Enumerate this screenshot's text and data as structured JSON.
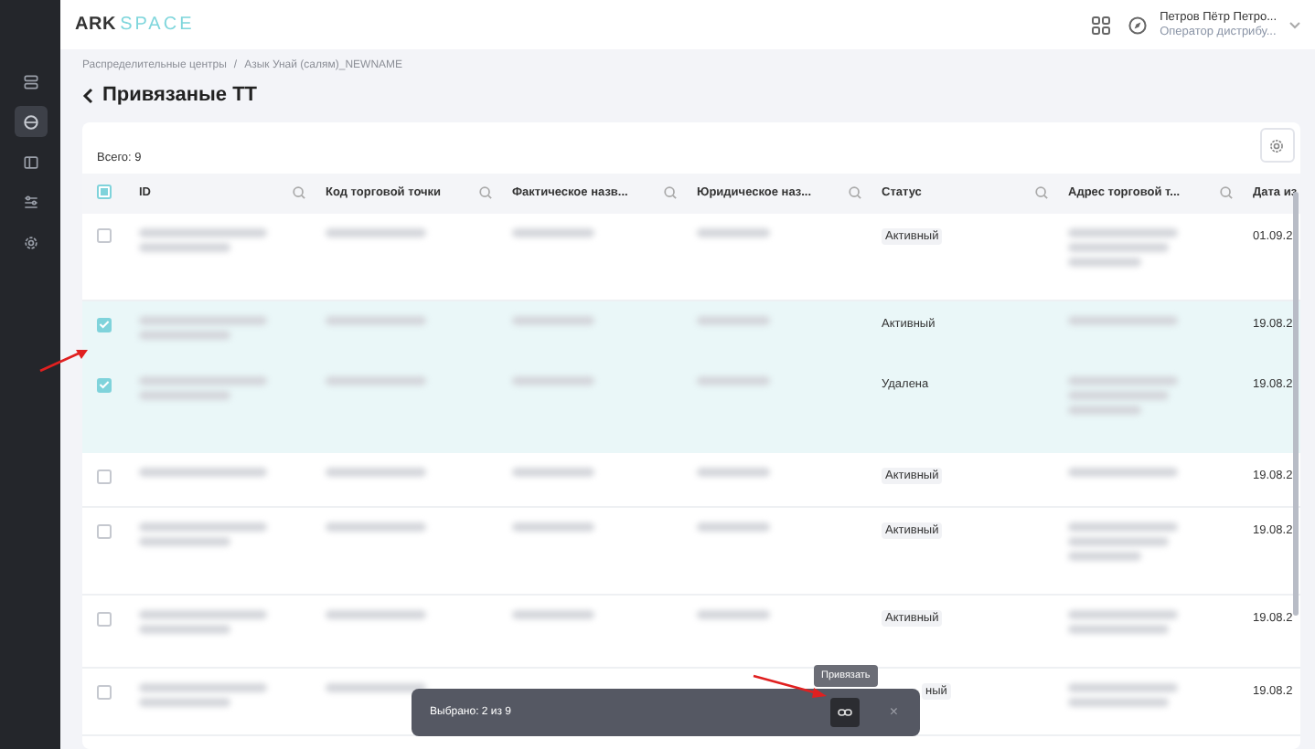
{
  "logo": {
    "part_1": "ARK",
    "part_2": "SPACE"
  },
  "sidebar": {
    "items": [
      {
        "selected": false
      },
      {
        "selected": true
      },
      {
        "selected": false
      },
      {
        "selected": false
      },
      {
        "selected": false
      }
    ]
  },
  "user": {
    "name": "Петров Пётр Петро...",
    "role": "Оператор дистрибу..."
  },
  "breadcrumb": {
    "items": [
      "Распределительные центры",
      "Азык Унай (салям)_NEWNAME"
    ],
    "separator": "/"
  },
  "title": "Привязаные ТТ",
  "total": "Всего: 9",
  "table": {
    "select_all": {
      "indeterminate": true
    },
    "columns": [
      {
        "label": "ID",
        "search": true
      },
      {
        "label": "Код торговой точки",
        "search": true
      },
      {
        "label": "Фактическое назв...",
        "search": true
      },
      {
        "label": "Юридическое наз...",
        "search": true
      },
      {
        "label": "Статус",
        "search": true
      },
      {
        "label": "Адрес торговой т...",
        "search": true
      },
      {
        "label": "Дата из",
        "search": false
      }
    ],
    "rows": [
      {
        "selected": false,
        "status": "Активный",
        "status_tag": true,
        "date": "01.09.2"
      },
      {
        "selected": true,
        "status": "Активный",
        "status_tag": false,
        "date": "19.08.2"
      },
      {
        "selected": true,
        "status": "Удалена",
        "status_tag": false,
        "date": "19.08.2"
      },
      {
        "selected": false,
        "status": "Активный",
        "status_tag": true,
        "date": "19.08.2"
      },
      {
        "selected": false,
        "status": "Активный",
        "status_tag": true,
        "date": "19.08.2"
      },
      {
        "selected": false,
        "status": "Активный",
        "status_tag": true,
        "date": "19.08.2"
      },
      {
        "selected": false,
        "status": "ный",
        "status_tag": true,
        "covered": true,
        "date": "19.08.2"
      }
    ]
  },
  "selection_bar": {
    "text": "Выбрано: 2 из 9",
    "tooltip": "Привязать",
    "close": "×"
  }
}
